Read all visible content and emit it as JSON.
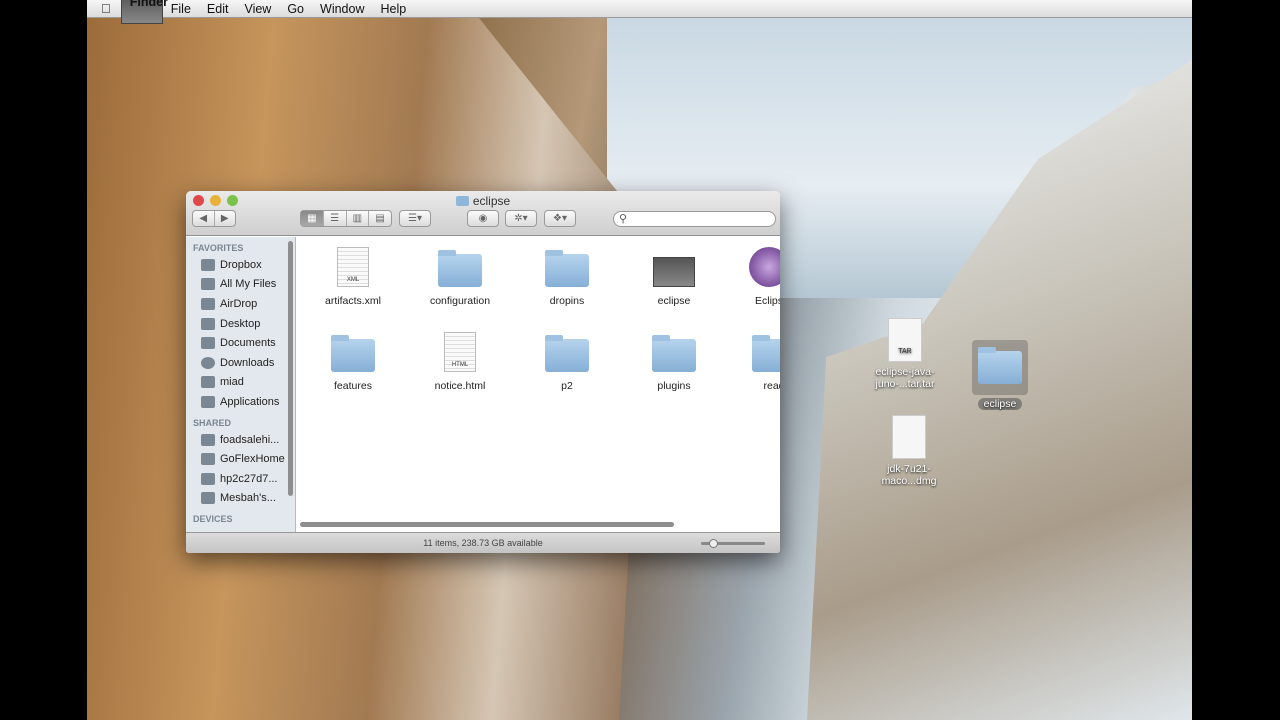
{
  "menubar": {
    "app": "Finder",
    "items": [
      "File",
      "Edit",
      "View",
      "Go",
      "Window",
      "Help"
    ]
  },
  "window": {
    "title": "eclipse",
    "search_placeholder": "",
    "sidebar": {
      "favorites_heading": "FAVORITES",
      "favorites": [
        "Dropbox",
        "All My Files",
        "AirDrop",
        "Desktop",
        "Documents",
        "Downloads",
        "miad",
        "Applications"
      ],
      "shared_heading": "SHARED",
      "shared": [
        "foadsalehi...",
        "GoFlexHome",
        "hp2c27d7...",
        "Mesbah's..."
      ],
      "devices_heading": "DEVICES"
    },
    "items": [
      {
        "name": "artifacts.xml",
        "kind": "doc",
        "badge": "XML"
      },
      {
        "name": "configuration",
        "kind": "folder"
      },
      {
        "name": "dropins",
        "kind": "folder"
      },
      {
        "name": "eclipse",
        "kind": "app"
      },
      {
        "name": "Eclips",
        "kind": "eclipse-app"
      },
      {
        "name": "features",
        "kind": "folder"
      },
      {
        "name": "notice.html",
        "kind": "doc",
        "badge": "HTML"
      },
      {
        "name": "p2",
        "kind": "folder"
      },
      {
        "name": "plugins",
        "kind": "folder"
      },
      {
        "name": "read",
        "kind": "folder"
      }
    ],
    "status": "11 items, 238.73 GB available"
  },
  "desktop": [
    {
      "name": "eclipse-java-juno-...tar.tar",
      "badge": "TAR"
    },
    {
      "name": "eclipse"
    },
    {
      "name": "jdk-7u21-maco...dmg"
    }
  ]
}
